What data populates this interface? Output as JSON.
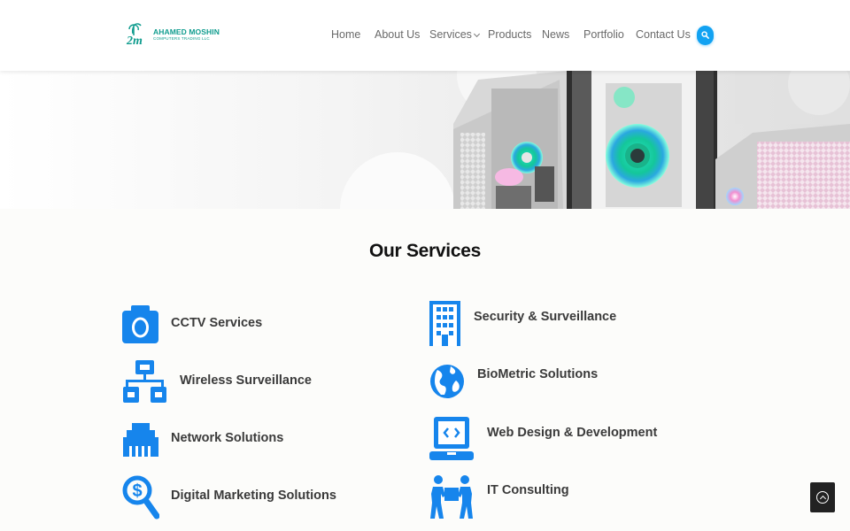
{
  "brand": {
    "name": "AHAMED MOSHIN",
    "subtitle": "COMPUTERS TRADING LLC",
    "color": "#0f9c8e"
  },
  "nav": {
    "items": [
      {
        "label": "Home"
      },
      {
        "label": "About Us"
      },
      {
        "label": "Services"
      },
      {
        "label": "Products"
      },
      {
        "label": "News"
      },
      {
        "label": "Portfolio"
      },
      {
        "label": "Contact Us"
      }
    ],
    "search_icon": "search-icon",
    "accent": "#12a2f2"
  },
  "hero": {
    "image": "pc-cases-rgb-fans"
  },
  "services": {
    "title": "Our Services",
    "icon_color": "#1685ec",
    "items": [
      {
        "label": "CCTV Services",
        "icon": "camera-icon"
      },
      {
        "label": "Security & Surveillance",
        "icon": "building-icon"
      },
      {
        "label": "Wireless Surveillance",
        "icon": "network-icon"
      },
      {
        "label": "BioMetric Solutions",
        "icon": "globe-icon"
      },
      {
        "label": "Network Solutions",
        "icon": "ethernet-icon"
      },
      {
        "label": "Web Design & Development",
        "icon": "laptop-code-icon"
      },
      {
        "label": "Digital Marketing Solutions",
        "icon": "search-dollar-icon"
      },
      {
        "label": "IT Consulting",
        "icon": "people-carry-icon"
      }
    ]
  },
  "scroll_top": {
    "icon": "arrow-up-circle-icon"
  }
}
